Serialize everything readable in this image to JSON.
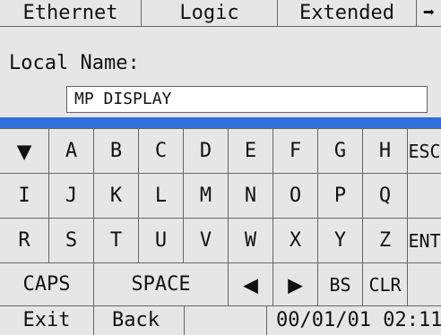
{
  "tabs": [
    {
      "label": "Ethernet"
    },
    {
      "label": "Logic"
    },
    {
      "label": "Extended"
    },
    {
      "label": "➡",
      "icon": "arrow-right-icon"
    }
  ],
  "form": {
    "local_name_label": "Local Name:",
    "local_name_value": "MP DISPLAY"
  },
  "keyboard": {
    "row1": [
      "▼",
      "A",
      "B",
      "C",
      "D",
      "E",
      "F",
      "G",
      "H",
      "ESC"
    ],
    "row2": [
      "I",
      "J",
      "K",
      "L",
      "M",
      "N",
      "O",
      "P",
      "Q"
    ],
    "row3": [
      "R",
      "S",
      "T",
      "U",
      "V",
      "W",
      "X",
      "Y",
      "Z",
      "ENT"
    ],
    "row4": {
      "caps": "CAPS",
      "space": "SPACE",
      "left": "◀",
      "right": "▶",
      "bs": "BS",
      "clr": "CLR"
    }
  },
  "bottom": {
    "exit": "Exit",
    "back": "Back",
    "datetime": "00/01/01 02:11"
  },
  "colors": {
    "accent_blue": "#2f6fdb",
    "panel_bg": "#e6e6e6",
    "field_bg": "#ffffff",
    "border": "#666666"
  }
}
